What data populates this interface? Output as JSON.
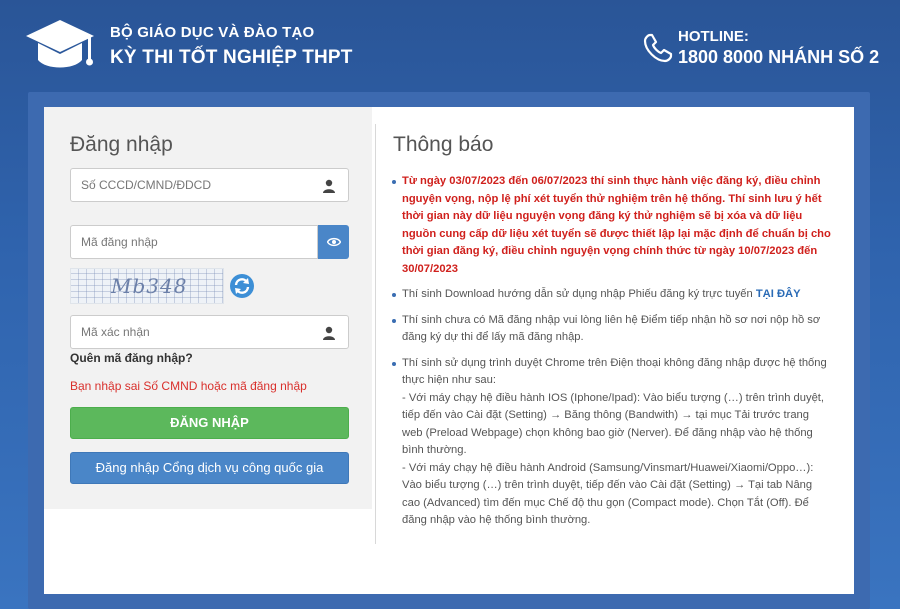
{
  "header": {
    "org_name": "BỘ GIÁO DỤC VÀ ĐÀO TẠO",
    "exam_name": "KỲ THI TỐT NGHIỆP THPT",
    "hotline_label": "HOTLINE:",
    "hotline_number": "1800 8000 NHÁNH SỐ 2"
  },
  "login": {
    "title": "Đăng nhập",
    "id_placeholder": "Số CCCD/CMND/ĐDCD",
    "code_placeholder": "Mã đăng nhập",
    "captcha_text": "Mb348",
    "captcha_placeholder": "Mã xác nhận",
    "forgot_label": "Quên mã đăng nhập?",
    "error_message": "Bạn nhập sai Số CMND hoặc mã đăng nhập",
    "login_button": "ĐĂNG NHẬP",
    "portal_button": "Đăng nhập Cổng dịch vụ công quốc gia"
  },
  "notices": {
    "title": "Thông báo",
    "item1": "Từ ngày 03/07/2023 đến 06/07/2023 thí sinh thực hành việc đăng ký, điều chỉnh nguyện vọng, nộp lệ phí xét tuyển thử nghiệm trên hệ thống. Thí sinh lưu ý hết thời gian này dữ liệu nguyện vọng đăng ký thử nghiệm sẽ bị xóa và dữ liệu nguồn cung cấp dữ liệu xét tuyển sẽ được thiết lập lại mặc định để chuẩn bị cho thời gian đăng ký, điều chỉnh nguyện vọng chính thức từ ngày 10/07/2023 đến 30/07/2023",
    "item2_text": "Thí sinh Download hướng dẫn sử dụng nhập Phiếu đăng ký trực tuyến ",
    "item2_link": "TẠI ĐÂY",
    "item3": "Thí sinh chưa có Mã đăng nhập vui lòng liên hệ Điểm tiếp nhận hồ sơ nơi nộp hồ sơ đăng ký dự thi để lấy mã đăng nhập.",
    "item4_intro": "Thí sinh sử dụng trình duyệt Chrome trên Điện thoại không đăng nhập được hệ thống thực hiện như sau:",
    "item4_ios": " - Với máy chạy hệ điều hành IOS (Iphone/Ipad): Vào biểu tượng (…) trên trình duyệt, tiếp đến vào Cài đặt (Setting) → Băng thông (Bandwith) → tại mục Tải trước trang web (Preload Webpage) chọn không bao giờ (Nerver). Để đăng nhập vào hệ thống bình thường.",
    "item4_android": " - Với máy chạy hệ điều hành Android (Samsung/Vinsmart/Huawei/Xiaomi/Oppo…): Vào biểu tượng (…) trên trình duyệt, tiếp đến vào Cài đặt (Setting) → Tại tab Nâng cao (Advanced) tìm đến mục Chế độ thu gọn (Compact mode). Chọn Tắt (Off). Để đăng nhập vào hệ thống bình thường."
  },
  "colors": {
    "background": "#2f63ad",
    "login_green": "#5cb85c",
    "portal_blue": "#4a86c8",
    "error_red": "#d9302c"
  },
  "icons": [
    "graduation-cap-icon",
    "phone-icon",
    "user-icon",
    "eye-icon",
    "refresh-icon"
  ]
}
